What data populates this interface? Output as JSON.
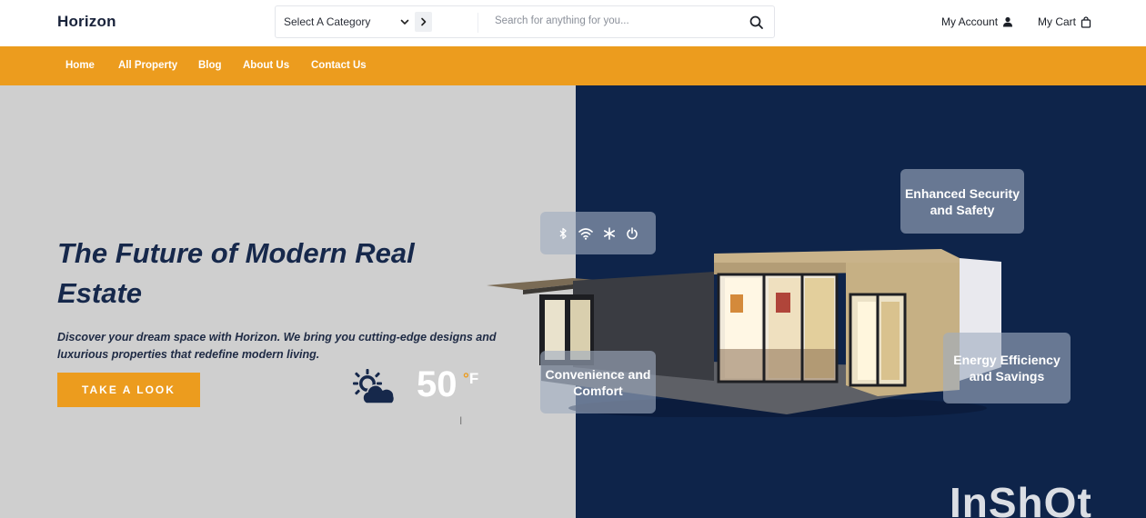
{
  "header": {
    "logo": "Horizon",
    "category_label": "Select A Category",
    "search_placeholder": "Search for anything for you...",
    "account_label": "My Account",
    "cart_label": "My Cart"
  },
  "nav": {
    "items": [
      "Home",
      "All Property",
      "Blog",
      "About Us",
      "Contact Us"
    ]
  },
  "hero": {
    "headline": "The Future of Modern Real Estate",
    "subtext": "Discover your dream space with Horizon. We bring you cutting-edge designs and luxurious properties that redefine modern living.",
    "cta_label": "TAKE A LOOK",
    "temperature": "50",
    "temp_degree": "°",
    "temp_unit": "F",
    "features": {
      "security": "Enhanced Security and Safety",
      "energy": "Energy Efficiency and Savings",
      "comfort": "Convenience and Comfort"
    },
    "controls": [
      "bluetooth-icon",
      "wifi-icon",
      "snowflake-icon",
      "power-icon"
    ]
  },
  "watermark": "InShOt",
  "colors": {
    "accent": "#ec9c1e",
    "navy": "#0e244a",
    "hero_left_bg": "#cfcfcf",
    "headline": "#16284b"
  }
}
